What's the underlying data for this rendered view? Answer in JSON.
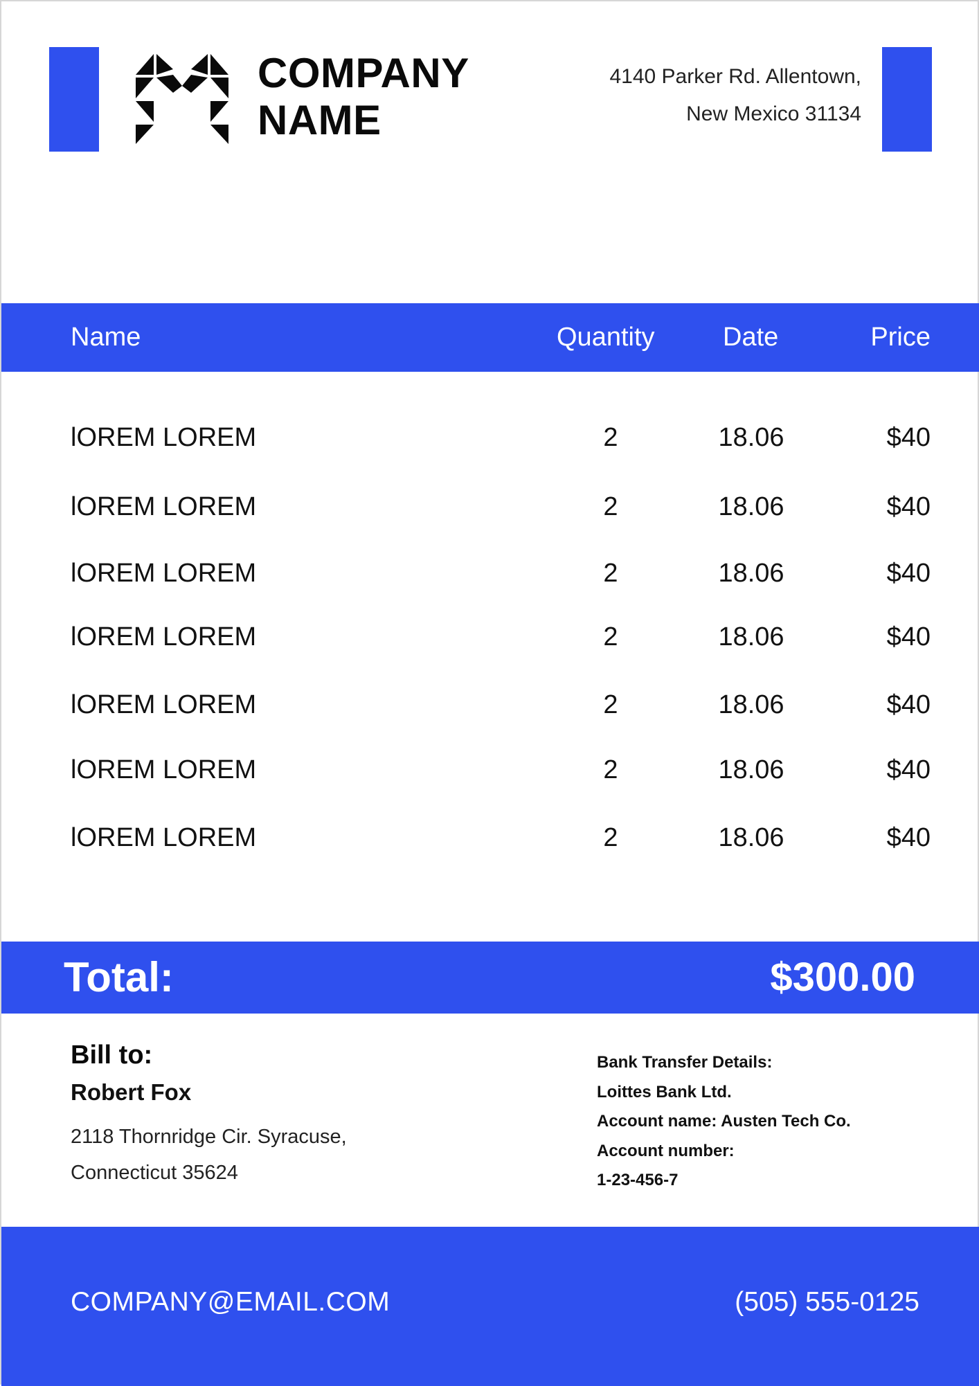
{
  "header": {
    "company_name_line1": "COMPANY",
    "company_name_line2": "NAME",
    "address_line1": "4140 Parker Rd. Allentown,",
    "address_line2": "New Mexico 31134"
  },
  "colors": {
    "accent": "#2f50ee",
    "text": "#111111",
    "background": "#ffffff"
  },
  "table": {
    "headers": {
      "name": "Name",
      "quantity": "Quantity",
      "date": "Date",
      "price": "Price"
    },
    "rows": [
      {
        "name": "lOREM LOREM",
        "quantity": "2",
        "date": "18.06",
        "price": "$40"
      },
      {
        "name": "lOREM LOREM",
        "quantity": "2",
        "date": "18.06",
        "price": "$40"
      },
      {
        "name": "lOREM LOREM",
        "quantity": "2",
        "date": "18.06",
        "price": "$40"
      },
      {
        "name": "lOREM LOREM",
        "quantity": "2",
        "date": "18.06",
        "price": "$40"
      },
      {
        "name": "lOREM LOREM",
        "quantity": "2",
        "date": "18.06",
        "price": "$40"
      },
      {
        "name": "lOREM LOREM",
        "quantity": "2",
        "date": "18.06",
        "price": "$40"
      },
      {
        "name": "lOREM LOREM",
        "quantity": "2",
        "date": "18.06",
        "price": "$40"
      }
    ]
  },
  "total": {
    "label": "Total:",
    "value": "$300.00"
  },
  "bill_to": {
    "title": "Bill to:",
    "client_name": "Robert Fox",
    "address_line1": "2118 Thornridge Cir. Syracuse,",
    "address_line2": "Connecticut 35624"
  },
  "bank": {
    "line1": "Bank Transfer Details:",
    "line2": "Loittes Bank Ltd.",
    "line3": "Account name: Austen Tech Co.",
    "line4": "Account number:",
    "line5": "1-23-456-7"
  },
  "footer": {
    "email": "COMPANY@EMAIL.COM",
    "phone": "(505) 555-0125"
  },
  "icons": {
    "logo": "geometric-m-logo-icon"
  }
}
